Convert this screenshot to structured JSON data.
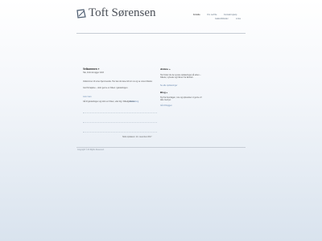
{
  "site": {
    "title": "Toft Sørensen"
  },
  "nav": {
    "items": [
      {
        "label": "Forside"
      },
      {
        "label": "Om os/Ole"
      },
      {
        "label": "Kontakt Hjælp"
      },
      {
        "label": "Galleri/billeder"
      },
      {
        "label": "Links"
      }
    ]
  },
  "main": {
    "heading": "Velkommen »",
    "intro": "Tak, fordi du kigger forbi!",
    "body1": "Velkommen til vores hjemmeside. Her kan du læse lidt om os og se vores billeder.",
    "body2": "God fornøjelse – skriv gerne en hilsen i gæstebogen.",
    "small_link": "Læs mere",
    "body3": "Gå til gæstebogen og skriv en hilsen, eller kig i billedgalleriet.",
    "link_text": "Gæstebog",
    "updated": "Sidst opdateret: 12. november 2017"
  },
  "sidebar": {
    "about_heading": "Ældste »",
    "about_text": "Her finder du de nyeste opdateringer på siden – billeder, nyheder og hilsner fra familien.",
    "about_link": "Se alle opdateringer",
    "blog_heading": "Blog »",
    "blog_text": "Nyt fra hverdagen, ture og oplevelser vi gerne vil dele med jer.",
    "blog_link": "Gå til bloggen"
  },
  "footer": {
    "copyright": "Copyright © All Rights Reserved."
  },
  "colors": {
    "title": "#4a4f57",
    "link": "#6a8ab0",
    "rule": "#c7cdd5"
  }
}
